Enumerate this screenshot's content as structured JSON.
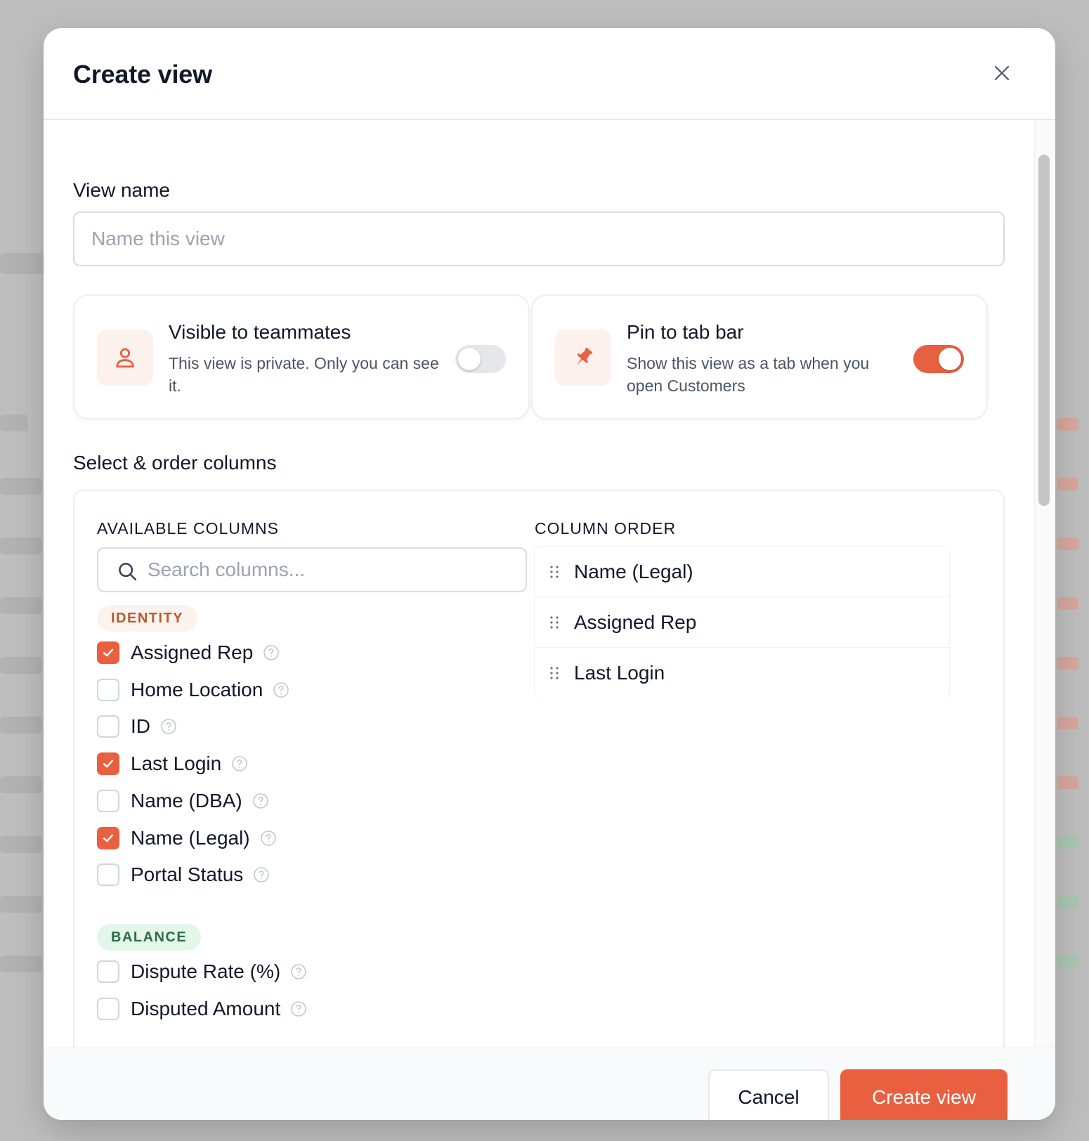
{
  "modal": {
    "title": "Create view",
    "close_label": "close"
  },
  "view_name": {
    "label": "View name",
    "placeholder": "Name this view",
    "value": ""
  },
  "options": [
    {
      "title": "Visible to teammates",
      "description": "This view is private. Only you can see it.",
      "icon": "user-icon",
      "enabled": false
    },
    {
      "title": "Pin to tab bar",
      "description": "Show this view as a tab when you open Customers",
      "icon": "pin-icon",
      "enabled": true
    }
  ],
  "columns": {
    "section_label": "Select & order columns",
    "available_heading": "AVAILABLE COLUMNS",
    "order_heading": "COLUMN ORDER",
    "search_placeholder": "Search columns...",
    "groups": [
      {
        "name": "IDENTITY",
        "items": [
          {
            "label": "Assigned Rep",
            "checked": true
          },
          {
            "label": "Home Location",
            "checked": false
          },
          {
            "label": "ID",
            "checked": false
          },
          {
            "label": "Last Login",
            "checked": true
          },
          {
            "label": "Name (DBA)",
            "checked": false
          },
          {
            "label": "Name (Legal)",
            "checked": true
          },
          {
            "label": "Portal Status",
            "checked": false
          }
        ]
      },
      {
        "name": "BALANCE",
        "items": [
          {
            "label": "Dispute Rate (%)",
            "checked": false
          },
          {
            "label": "Disputed Amount",
            "checked": false
          }
        ]
      }
    ],
    "order": [
      "Name (Legal)",
      "Assigned Rep",
      "Last Login"
    ]
  },
  "footer": {
    "cancel_label": "Cancel",
    "create_label": "Create view"
  },
  "colors": {
    "accent": "#e8603f",
    "identity_badge_text": "#b45c2c",
    "balance_badge_text": "#2f6b47"
  }
}
